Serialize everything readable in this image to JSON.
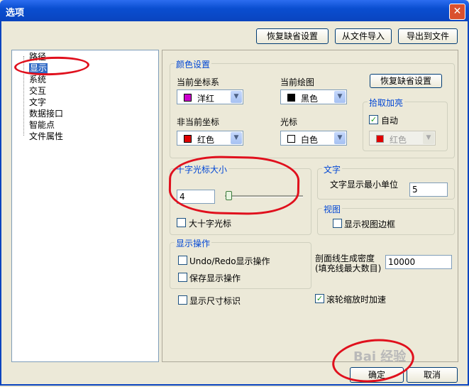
{
  "window": {
    "title": "选项",
    "close_icon": "close-icon"
  },
  "top_buttons": {
    "restore_defaults": "恢复缺省设置",
    "import_file": "从文件导入",
    "export_file": "导出到文件"
  },
  "tree": {
    "items": [
      "路径",
      "显示",
      "系统",
      "交互",
      "文字",
      "数据接口",
      "智能点",
      "文件属性"
    ],
    "selected": "显示"
  },
  "color_group": {
    "title": "颜色设置",
    "current_axis_label": "当前坐标系",
    "current_axis_value": "洋红",
    "current_axis_color": "#cc00cc",
    "current_draw_label": "当前绘图",
    "current_draw_value": "黑色",
    "current_draw_color": "#000000",
    "noncurrent_axis_label": "非当前坐标",
    "noncurrent_axis_value": "红色",
    "noncurrent_axis_color": "#e00000",
    "cursor_label": "光标",
    "cursor_value": "白色",
    "cursor_color": "#ffffff",
    "restore_defaults": "恢复缺省设置"
  },
  "pick_highlight": {
    "title": "拾取加亮",
    "auto_label": "自动",
    "auto_checked": true,
    "color_value": "红色",
    "color_swatch": "#e00000"
  },
  "crosshair": {
    "title": "十字光标大小",
    "value": "4",
    "slider_fraction": 0.02,
    "big_crosshair_label": "大十字光标",
    "big_crosshair_checked": false
  },
  "text_group": {
    "title": "文字",
    "min_unit_label": "文字显示最小单位",
    "min_unit_value": "5"
  },
  "view_group": {
    "title": "视图",
    "show_border_label": "显示视图边框",
    "show_border_checked": false
  },
  "display_ops": {
    "title": "显示操作",
    "undo_redo_label": "Undo/Redo显示操作",
    "undo_redo_checked": false,
    "save_label": "保存显示操作",
    "save_checked": false
  },
  "hatch": {
    "label_line1": "剖面线生成密度",
    "label_line2": "(填充线最大数目)",
    "value": "10000"
  },
  "show_dims": {
    "label": "显示尺寸标识",
    "checked": false
  },
  "wheel_zoom": {
    "label": "滚轮缩放时加速",
    "checked": true
  },
  "bottom_buttons": {
    "ok": "确定",
    "cancel": "取消"
  },
  "watermark": {
    "text": "Bai 经验"
  },
  "accent_colors": {
    "titlebar": "#0a4ed0",
    "annotation_red": "#e0101d"
  }
}
